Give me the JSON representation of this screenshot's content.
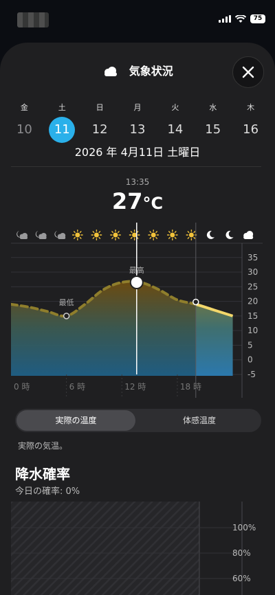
{
  "status": {
    "battery": "75"
  },
  "header": {
    "title": "気象状況",
    "close_icon": "close-icon"
  },
  "days": [
    {
      "dow": "金",
      "num": "10"
    },
    {
      "dow": "土",
      "num": "11"
    },
    {
      "dow": "日",
      "num": "12"
    },
    {
      "dow": "月",
      "num": "13"
    },
    {
      "dow": "火",
      "num": "14"
    },
    {
      "dow": "水",
      "num": "15"
    },
    {
      "dow": "木",
      "num": "16"
    }
  ],
  "selected_day": 1,
  "date_line": "2026 年 4月11日 土曜日",
  "current": {
    "time": "13:35",
    "temp": "27",
    "unit": "°C"
  },
  "chart_data": {
    "type": "area",
    "title": "",
    "xlabel": "",
    "ylabel": "",
    "x_ticks": [
      "0 時",
      "6 時",
      "12 時",
      "18 時"
    ],
    "y_ticks": [
      35,
      30,
      25,
      20,
      15,
      10,
      5,
      0,
      -5
    ],
    "ylim": [
      -5,
      38
    ],
    "xlim": [
      0,
      25
    ],
    "hourly_icons": [
      "moon-cloud",
      "moon-cloud",
      "moon-cloud",
      "sun",
      "sun",
      "sun",
      "sun",
      "sun",
      "sun",
      "sun",
      "moon",
      "moon",
      "cloud"
    ],
    "series": [
      {
        "x": [
          0,
          2,
          4,
          6,
          8,
          10,
          12,
          14,
          16,
          18,
          20,
          22,
          24
        ],
        "values": [
          19,
          18,
          16.5,
          15,
          19,
          24,
          26.5,
          26.5,
          24,
          20.5,
          19,
          17,
          15
        ]
      }
    ],
    "low_label": "最低",
    "high_label": "最高",
    "current_hour": 13.6
  },
  "segment": {
    "actual": "実際の温度",
    "feels": "体感温度"
  },
  "note": "実際の気温。",
  "precip": {
    "title": "降水確率",
    "subtitle": "今日の確率: 0%",
    "y_ticks": [
      "100%",
      "80%",
      "60%"
    ]
  }
}
